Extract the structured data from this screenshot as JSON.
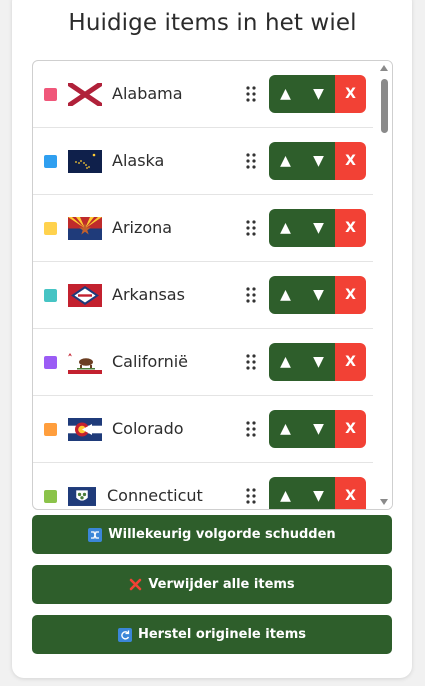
{
  "title": "Huidige items in het wiel",
  "items": [
    {
      "name": "Alabama",
      "color": "#f0577a",
      "flag": "alabama"
    },
    {
      "name": "Alaska",
      "color": "#2f9ff0",
      "flag": "alaska"
    },
    {
      "name": "Arizona",
      "color": "#ffd24d",
      "flag": "arizona"
    },
    {
      "name": "Arkansas",
      "color": "#46c4c4",
      "flag": "arkansas"
    },
    {
      "name": "Californië",
      "color": "#9b5cf5",
      "flag": "california"
    },
    {
      "name": "Colorado",
      "color": "#ff9e3d",
      "flag": "colorado"
    },
    {
      "name": "Connecticut",
      "color": "#8bc34a",
      "flag": "connecticut"
    }
  ],
  "row_buttons": {
    "up": "▲",
    "down": "▼",
    "delete": "X"
  },
  "actions": {
    "shuffle": {
      "icon": "shuffle-icon",
      "label": "Willekeurig volgorde schudden"
    },
    "delete_all": {
      "icon": "cross-mark-icon",
      "label": "Verwijder alle items"
    },
    "restore": {
      "icon": "refresh-icon",
      "label": "Herstel originele items"
    }
  },
  "colors": {
    "primary": "#2e5e2b",
    "danger": "#f24135"
  }
}
